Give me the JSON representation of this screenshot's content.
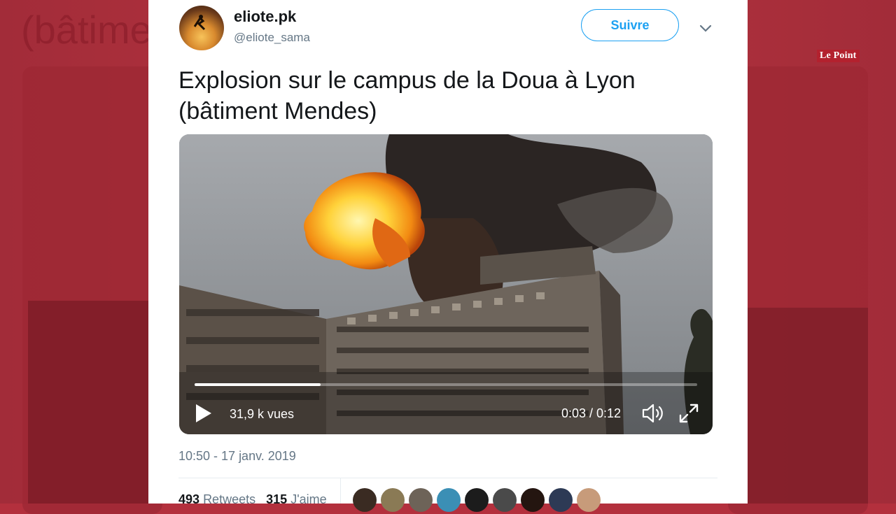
{
  "watermark": "Le Point",
  "tweet": {
    "display_name": "eliote.pk",
    "handle": "@eliote_sama",
    "follow_label": "Suivre",
    "text_line1": "Explosion sur le campus de la Doua à Lyon",
    "text_line2": "(bâtiment Mendes)",
    "timestamp": "10:50 - 17 janv. 2019",
    "retweets_count": "493",
    "retweets_label": "Retweets",
    "likes_count": "315",
    "likes_label": "J'aime"
  },
  "video": {
    "views": "31,9 k vues",
    "time": "0:03 / 0:12",
    "progress": 0.25
  },
  "likers": [
    "#3a2b22",
    "#8a7a55",
    "#6d6358",
    "#3b8fb5",
    "#1c1c1c",
    "#4a4a4a",
    "#241510",
    "#2d3a55",
    "#c79b7a"
  ],
  "icons": {
    "play": "play-icon",
    "volume": "volume-icon",
    "fullscreen": "fullscreen-icon",
    "chevron": "chevron-down-icon"
  }
}
